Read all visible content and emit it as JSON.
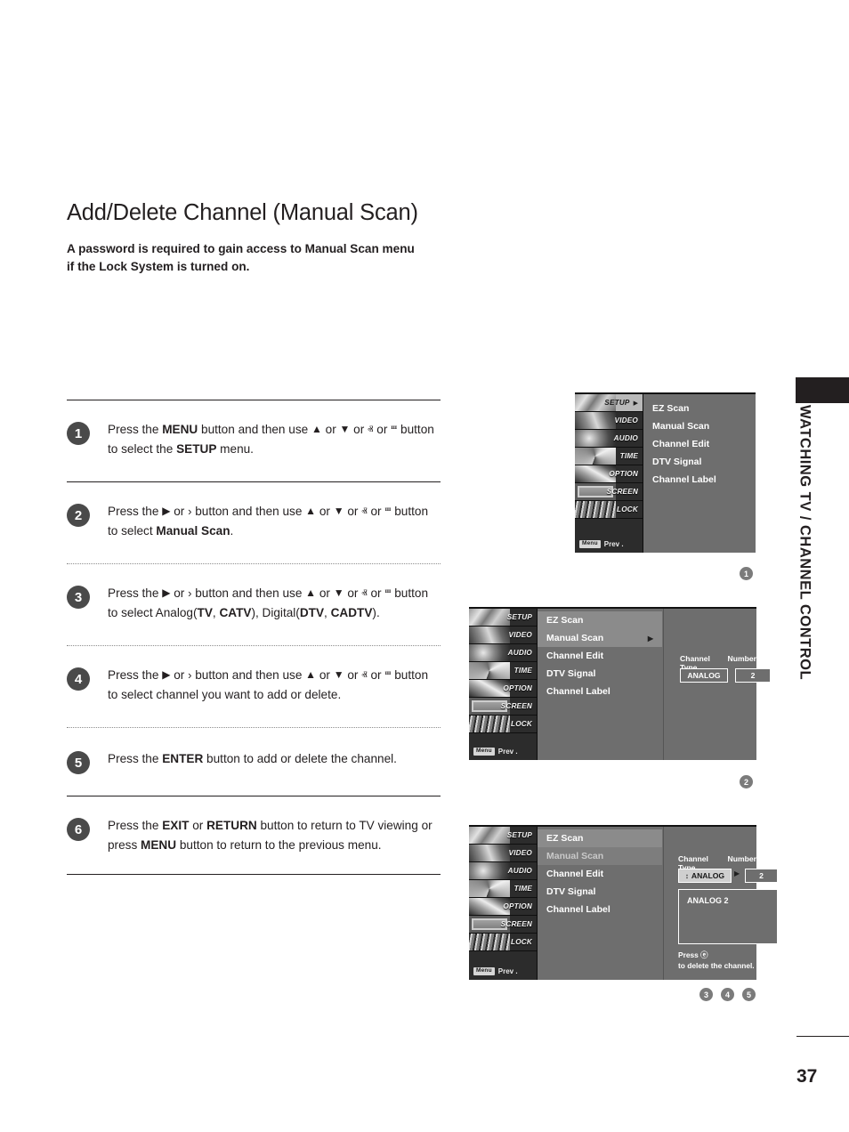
{
  "page": {
    "title": "Add/Delete Channel (Manual Scan)",
    "intro": "A password is required to gain access to Manual Scan menu if the Lock System is turned on.",
    "side_label": "WATCHING TV / CHANNEL CONTROL",
    "page_number": "37"
  },
  "steps": [
    {
      "number": "1",
      "segments": [
        {
          "t": "Press the ",
          "b": false
        },
        {
          "t": "MENU",
          "b": true
        },
        {
          "t": " button and then use ",
          "b": false
        },
        {
          "t": "▲",
          "b": false,
          "icon": "up-triangle"
        },
        {
          "t": " or ",
          "b": false
        },
        {
          "t": "▼",
          "b": false,
          "icon": "down-triangle"
        },
        {
          "t": " or ",
          "b": false
        },
        {
          "t": "ⱏ",
          "b": false,
          "icon": "up-chevron"
        },
        {
          "t": " or ",
          "b": false
        },
        {
          "t": "ⱎ",
          "b": false,
          "icon": "down-chevron"
        },
        {
          "t": " button to select the ",
          "b": false
        },
        {
          "t": "SETUP",
          "b": true
        },
        {
          "t": " menu.",
          "b": false
        }
      ]
    },
    {
      "number": "2",
      "segments": [
        {
          "t": "Press the ",
          "b": false
        },
        {
          "t": "▶",
          "b": false,
          "icon": "right-triangle"
        },
        {
          "t": " or ",
          "b": false
        },
        {
          "t": "›",
          "b": false,
          "icon": "right-chevron"
        },
        {
          "t": " button and then use ",
          "b": false
        },
        {
          "t": "▲",
          "b": false,
          "icon": "up-triangle"
        },
        {
          "t": " or ",
          "b": false
        },
        {
          "t": "▼",
          "b": false,
          "icon": "down-triangle"
        },
        {
          "t": " or ",
          "b": false
        },
        {
          "t": "ⱏ",
          "b": false,
          "icon": "up-chevron"
        },
        {
          "t": " or ",
          "b": false
        },
        {
          "t": "ⱎ",
          "b": false,
          "icon": "down-chevron"
        },
        {
          "t": " button to select ",
          "b": false
        },
        {
          "t": "Manual Scan",
          "b": true
        },
        {
          "t": ".",
          "b": false
        }
      ]
    },
    {
      "number": "3",
      "segments": [
        {
          "t": "Press the ",
          "b": false
        },
        {
          "t": "▶",
          "b": false,
          "icon": "right-triangle"
        },
        {
          "t": " or ",
          "b": false
        },
        {
          "t": "›",
          "b": false,
          "icon": "right-chevron"
        },
        {
          "t": " button and then use ",
          "b": false
        },
        {
          "t": "▲",
          "b": false,
          "icon": "up-triangle"
        },
        {
          "t": " or ",
          "b": false
        },
        {
          "t": "▼",
          "b": false,
          "icon": "down-triangle"
        },
        {
          "t": " or ",
          "b": false
        },
        {
          "t": "ⱏ",
          "b": false,
          "icon": "up-chevron"
        },
        {
          "t": " or ",
          "b": false
        },
        {
          "t": "ⱎ",
          "b": false,
          "icon": "down-chevron"
        },
        {
          "t": " button to select Analog(",
          "b": false
        },
        {
          "t": "TV",
          "b": true
        },
        {
          "t": ", ",
          "b": false
        },
        {
          "t": "CATV",
          "b": true
        },
        {
          "t": "), Digital(",
          "b": false
        },
        {
          "t": "DTV",
          "b": true
        },
        {
          "t": ", ",
          "b": false
        },
        {
          "t": "CADTV",
          "b": true
        },
        {
          "t": ").",
          "b": false
        }
      ]
    },
    {
      "number": "4",
      "segments": [
        {
          "t": "Press the ",
          "b": false
        },
        {
          "t": "▶",
          "b": false,
          "icon": "right-triangle"
        },
        {
          "t": " or ",
          "b": false
        },
        {
          "t": "›",
          "b": false,
          "icon": "right-chevron"
        },
        {
          "t": " button and then use ",
          "b": false
        },
        {
          "t": "▲",
          "b": false,
          "icon": "up-triangle"
        },
        {
          "t": " or ",
          "b": false
        },
        {
          "t": "▼",
          "b": false,
          "icon": "down-triangle"
        },
        {
          "t": " or ",
          "b": false
        },
        {
          "t": "ⱏ",
          "b": false,
          "icon": "up-chevron"
        },
        {
          "t": " or ",
          "b": false
        },
        {
          "t": "ⱎ",
          "b": false,
          "icon": "down-chevron"
        },
        {
          "t": " button to select channel you want to add or delete.",
          "b": false
        }
      ]
    },
    {
      "number": "5",
      "segments": [
        {
          "t": "Press the ",
          "b": false
        },
        {
          "t": "ENTER",
          "b": true
        },
        {
          "t": " button to add or delete the channel.",
          "b": false
        }
      ]
    },
    {
      "number": "6",
      "segments": [
        {
          "t": "Press the ",
          "b": false
        },
        {
          "t": "EXIT",
          "b": true
        },
        {
          "t": " or ",
          "b": false
        },
        {
          "t": "RETURN",
          "b": true
        },
        {
          "t": " button to return to TV viewing or press ",
          "b": false
        },
        {
          "t": "MENU",
          "b": true
        },
        {
          "t": " button to return to the previous menu.",
          "b": false
        }
      ]
    }
  ],
  "osd": {
    "sidebar_items": [
      {
        "label": "SETUP"
      },
      {
        "label": "VIDEO"
      },
      {
        "label": "AUDIO"
      },
      {
        "label": "TIME"
      },
      {
        "label": "OPTION"
      },
      {
        "label": "SCREEN"
      },
      {
        "label": "LOCK"
      }
    ],
    "prev_button": "Menu",
    "prev_text": "Prev .",
    "menu_items": [
      {
        "label": "EZ Scan"
      },
      {
        "label": "Manual Scan"
      },
      {
        "label": "Channel Edit"
      },
      {
        "label": "DTV Signal"
      },
      {
        "label": "Channel Label"
      }
    ],
    "cue_arrow": "▶",
    "pane": {
      "channel_type_label": "Channel Type",
      "number_label": "Number",
      "channel_type_value": "ANALOG",
      "number_value": "2",
      "spin_icon": "↕",
      "preview_text": "ANALOG  2",
      "note_line1": "Press ⓔ",
      "note_line2": "to delete the channel."
    }
  },
  "shot_badges": {
    "shot1": "1",
    "shot2": "2",
    "shot3a": "3",
    "shot3b": "4",
    "shot3c": "5"
  }
}
